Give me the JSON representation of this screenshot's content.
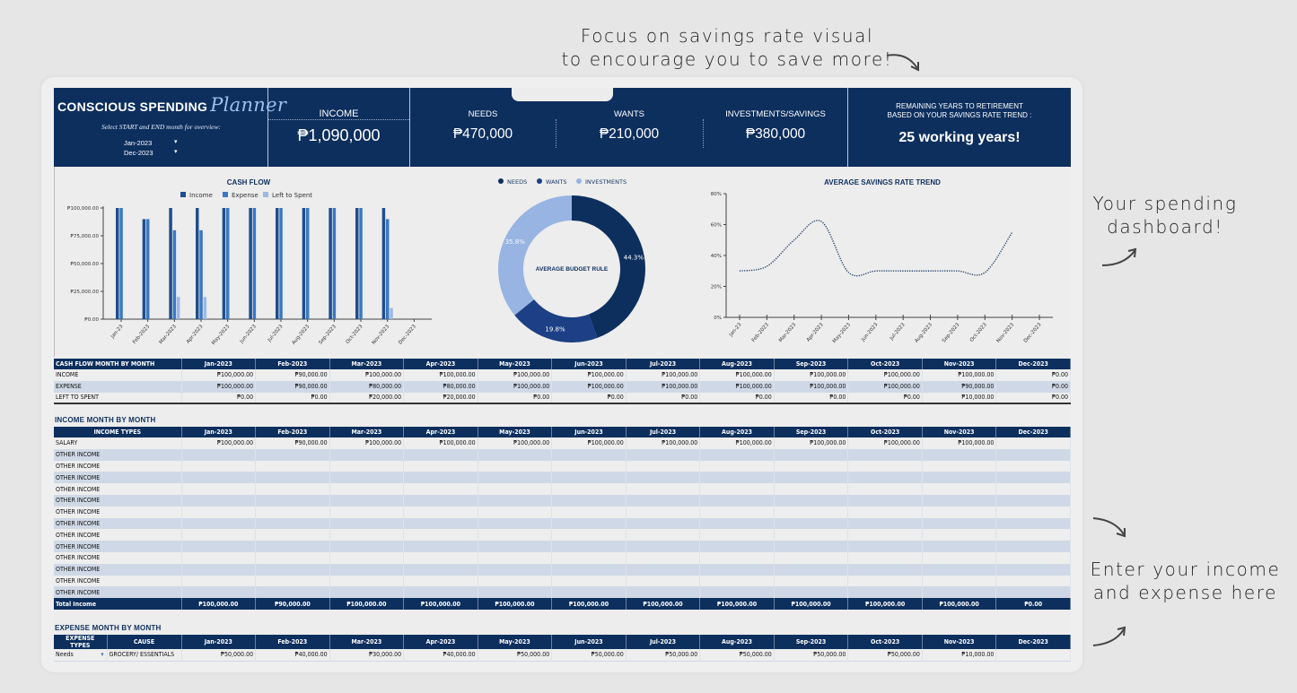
{
  "annotations": {
    "top": [
      "Focus on savings rate visual",
      "to encourage you to save more!"
    ],
    "right_dashboard": [
      "Your spending",
      "dashboard!"
    ],
    "right_enter": [
      "Enter your income",
      "and expense here"
    ]
  },
  "header": {
    "brand_title": "CONSCIOUS SPENDING",
    "brand_script": "Planner",
    "subtitle": "Select START and END month for overview:",
    "start_month": "Jan-2023",
    "end_month": "Dec-2023",
    "income_label": "INCOME",
    "income_value": "₱1,090,000",
    "needs_label": "NEEDS",
    "needs_value": "₱470,000",
    "wants_label": "WANTS",
    "wants_value": "₱210,000",
    "invest_label": "INVESTMENTS/SAVINGS",
    "invest_value": "₱380,000",
    "retire_label_1": "REMAINING YEARS TO RETIREMENT",
    "retire_label_2": "BASED ON YOUR SAVINGS RATE TREND :",
    "retire_value": "25 working years!"
  },
  "colors": {
    "navy": "#0d2f5e",
    "income": "#1f4e8c",
    "expense": "#3a78c2",
    "left": "#9db8e6",
    "needs": "#0d2f5e",
    "wants": "#1c3f85",
    "investments": "#98b4e3"
  },
  "chart_data": [
    {
      "type": "bar",
      "title": "CASH FLOW",
      "categories": [
        "Jan-23",
        "Feb-2023",
        "Mar-2023",
        "Apr-2023",
        "May-2023",
        "Jun-2023",
        "Jul-2023",
        "Aug-2023",
        "Sep-2023",
        "Oct-2023",
        "Nov-2023",
        "Dec-2023"
      ],
      "series": [
        {
          "name": "Income",
          "values": [
            100000,
            90000,
            100000,
            100000,
            100000,
            100000,
            100000,
            100000,
            100000,
            100000,
            100000,
            0
          ]
        },
        {
          "name": "Expense",
          "values": [
            100000,
            90000,
            80000,
            80000,
            100000,
            100000,
            100000,
            100000,
            100000,
            100000,
            90000,
            0
          ]
        },
        {
          "name": "Left to Spent",
          "values": [
            0,
            0,
            20000,
            20000,
            0,
            0,
            0,
            0,
            0,
            0,
            10000,
            0
          ]
        }
      ],
      "yticks": [
        "₱0.00",
        "₱25,000.00",
        "₱50,000.00",
        "₱75,000.00",
        "₱100,000.00"
      ],
      "ylim": [
        0,
        100000
      ],
      "legend": "top"
    },
    {
      "type": "pie",
      "title": "AVERAGE BUDGET RULE",
      "labels": [
        "NEEDS",
        "WANTS",
        "INVESTMENTS"
      ],
      "values": [
        44.3,
        19.8,
        35.8
      ],
      "value_labels": [
        "44.3%",
        "19.8%",
        "35.8%"
      ],
      "donut": true,
      "legend": "top"
    },
    {
      "type": "line",
      "title": "AVERAGE SAVINGS RATE TREND",
      "categories": [
        "Jan-23",
        "Feb-2023",
        "Mar-2023",
        "Apr-2023",
        "May-2023",
        "Jun-2023",
        "Jul-2023",
        "Aug-2023",
        "Sep-2023",
        "Oct-2023",
        "Nov-2023",
        "Dec-2023"
      ],
      "values": [
        30,
        33,
        50,
        62,
        29,
        30,
        30,
        30,
        30,
        29,
        55,
        null
      ],
      "yticks": [
        "0%",
        "20%",
        "40%",
        "60%",
        "80%"
      ],
      "ylim": [
        0,
        80
      ],
      "line_style": "dotted"
    }
  ],
  "months": [
    "Jan-2023",
    "Feb-2023",
    "Mar-2023",
    "Apr-2023",
    "May-2023",
    "Jun-2023",
    "Jul-2023",
    "Aug-2023",
    "Sep-2023",
    "Oct-2023",
    "Nov-2023",
    "Dec-2023"
  ],
  "cashflow_table": {
    "header": "CASH FLOW MONTH BY MONTH",
    "rows": [
      {
        "label": "INCOME",
        "values": [
          "₱100,000.00",
          "₱90,000.00",
          "₱100,000.00",
          "₱100,000.00",
          "₱100,000.00",
          "₱100,000.00",
          "₱100,000.00",
          "₱100,000.00",
          "₱100,000.00",
          "₱100,000.00",
          "₱100,000.00",
          "₱0.00"
        ]
      },
      {
        "label": "EXPENSE",
        "values": [
          "₱100,000.00",
          "₱90,000.00",
          "₱80,000.00",
          "₱80,000.00",
          "₱100,000.00",
          "₱100,000.00",
          "₱100,000.00",
          "₱100,000.00",
          "₱100,000.00",
          "₱100,000.00",
          "₱90,000.00",
          "₱0.00"
        ]
      },
      {
        "label": "LEFT TO SPENT",
        "values": [
          "₱0.00",
          "₱0.00",
          "₱20,000.00",
          "₱20,000.00",
          "₱0.00",
          "₱0.00",
          "₱0.00",
          "₱0.00",
          "₱0.00",
          "₱0.00",
          "₱10,000.00",
          "₱0.00"
        ]
      }
    ]
  },
  "income_table": {
    "section_label": "INCOME MONTH BY MONTH",
    "header": "INCOME TYPES",
    "rows": [
      {
        "label": "SALARY",
        "values": [
          "₱100,000.00",
          "₱90,000.00",
          "₱100,000.00",
          "₱100,000.00",
          "₱100,000.00",
          "₱100,000.00",
          "₱100,000.00",
          "₱100,000.00",
          "₱100,000.00",
          "₱100,000.00",
          "₱100,000.00",
          ""
        ]
      },
      {
        "label": "OTHER INCOME",
        "values": [
          "",
          "",
          "",
          "",
          "",
          "",
          "",
          "",
          "",
          "",
          "",
          ""
        ]
      },
      {
        "label": "OTHER INCOME",
        "values": [
          "",
          "",
          "",
          "",
          "",
          "",
          "",
          "",
          "",
          "",
          "",
          ""
        ]
      },
      {
        "label": "OTHER INCOME",
        "values": [
          "",
          "",
          "",
          "",
          "",
          "",
          "",
          "",
          "",
          "",
          "",
          ""
        ]
      },
      {
        "label": "OTHER INCOME",
        "values": [
          "",
          "",
          "",
          "",
          "",
          "",
          "",
          "",
          "",
          "",
          "",
          ""
        ]
      },
      {
        "label": "OTHER INCOME",
        "values": [
          "",
          "",
          "",
          "",
          "",
          "",
          "",
          "",
          "",
          "",
          "",
          ""
        ]
      },
      {
        "label": "OTHER INCOME",
        "values": [
          "",
          "",
          "",
          "",
          "",
          "",
          "",
          "",
          "",
          "",
          "",
          ""
        ]
      },
      {
        "label": "OTHER INCOME",
        "values": [
          "",
          "",
          "",
          "",
          "",
          "",
          "",
          "",
          "",
          "",
          "",
          ""
        ]
      },
      {
        "label": "OTHER INCOME",
        "values": [
          "",
          "",
          "",
          "",
          "",
          "",
          "",
          "",
          "",
          "",
          "",
          ""
        ]
      },
      {
        "label": "OTHER INCOME",
        "values": [
          "",
          "",
          "",
          "",
          "",
          "",
          "",
          "",
          "",
          "",
          "",
          ""
        ]
      },
      {
        "label": "OTHER INCOME",
        "values": [
          "",
          "",
          "",
          "",
          "",
          "",
          "",
          "",
          "",
          "",
          "",
          ""
        ]
      },
      {
        "label": "OTHER INCOME",
        "values": [
          "",
          "",
          "",
          "",
          "",
          "",
          "",
          "",
          "",
          "",
          "",
          ""
        ]
      },
      {
        "label": "OTHER INCOME",
        "values": [
          "",
          "",
          "",
          "",
          "",
          "",
          "",
          "",
          "",
          "",
          "",
          ""
        ]
      },
      {
        "label": "OTHER INCOME",
        "values": [
          "",
          "",
          "",
          "",
          "",
          "",
          "",
          "",
          "",
          "",
          "",
          ""
        ]
      }
    ],
    "total": {
      "label": "Total Income",
      "values": [
        "₱100,000.00",
        "₱90,000.00",
        "₱100,000.00",
        "₱100,000.00",
        "₱100,000.00",
        "₱100,000.00",
        "₱100,000.00",
        "₱100,000.00",
        "₱100,000.00",
        "₱100,000.00",
        "₱100,000.00",
        "₱0.00"
      ]
    }
  },
  "expense_table": {
    "section_label": "EXPENSE MONTH BY MONTH",
    "header_type": "EXPENSE TYPES",
    "header_cause": "CAUSE",
    "rows": [
      {
        "type": "Needs",
        "cause": "GROCERY/ ESSENTIALS",
        "values": [
          "₱50,000.00",
          "₱40,000.00",
          "₱30,000.00",
          "₱40,000.00",
          "₱50,000.00",
          "₱50,000.00",
          "₱50,000.00",
          "₱50,000.00",
          "₱50,000.00",
          "₱50,000.00",
          "₱10,000.00",
          ""
        ]
      }
    ]
  }
}
